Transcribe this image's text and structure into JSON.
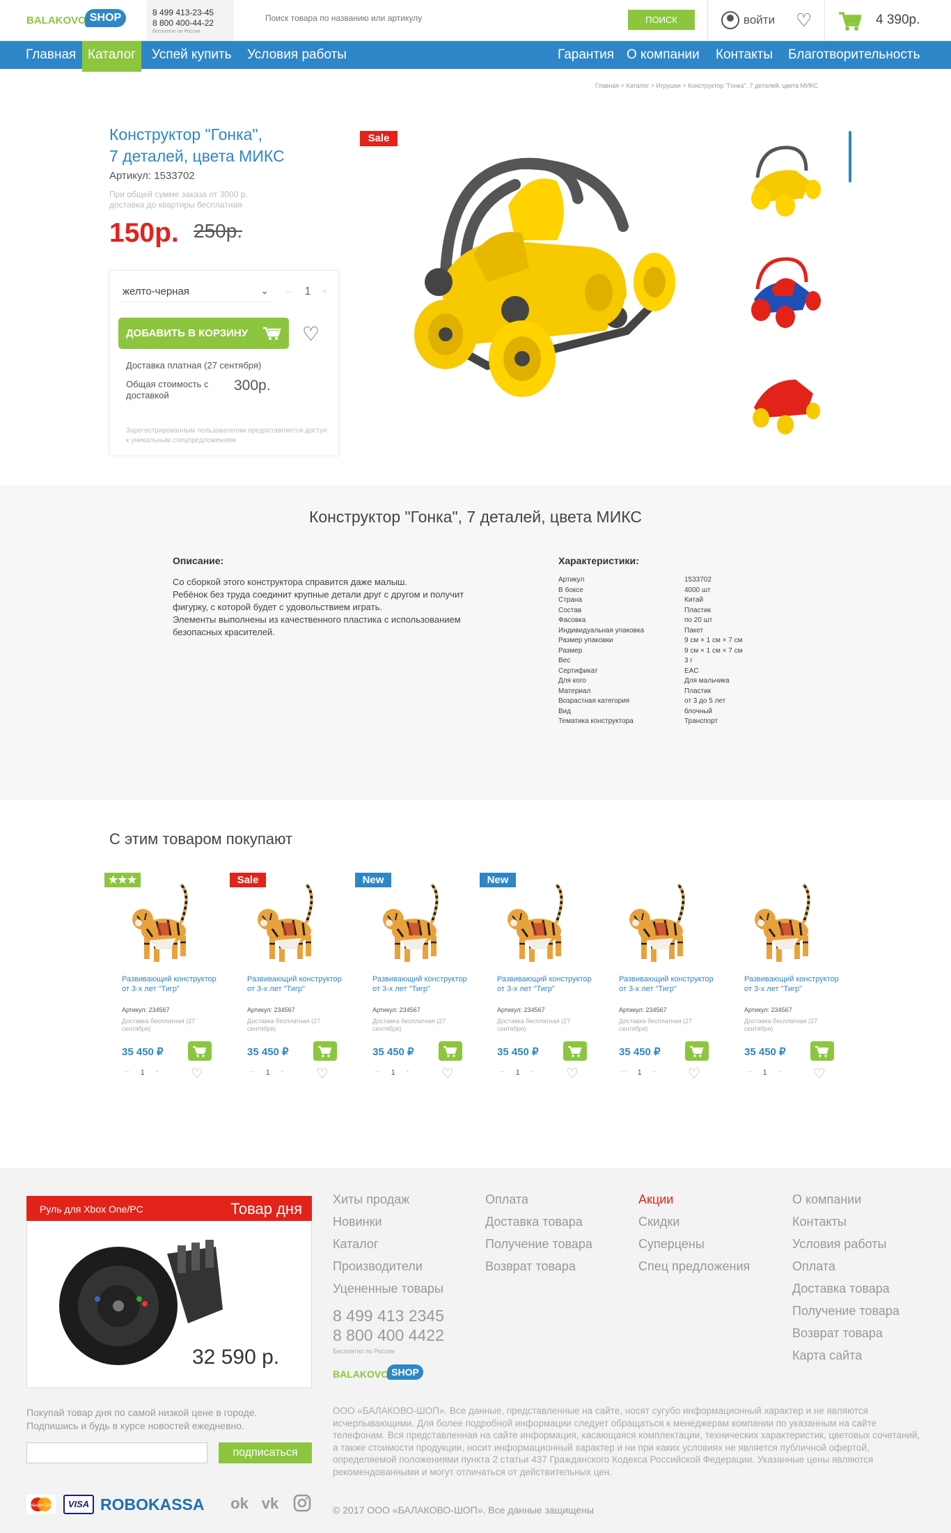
{
  "header": {
    "logo_part1": "BALAKOVO",
    "logo_part2": "SHOP",
    "phone1": "8 499 413-23-45",
    "phone2": "8 800 400-44-22",
    "phone_note": "бесплатно по России",
    "search_placeholder": "Поиск товара по названию или артикулу",
    "search_button": "ПОИСК",
    "login": "войти",
    "cart_total": "4 390р."
  },
  "nav": {
    "left": [
      "Главная",
      "Каталог",
      "Успей купить",
      "Условия работы"
    ],
    "right": [
      "Гарантия",
      "О компании",
      "Контакты",
      "Благотворительность"
    ],
    "active": "Каталог"
  },
  "breadcrumb": "Главная > Каталог > Игрушки > Конструктор \"Гонка\", 7 деталей, цвета МИКС",
  "product": {
    "title_line1": "Конструктор \"Гонка\",",
    "title_line2": "7 деталей, цвета МИКС",
    "article": "Артикул: 1533702",
    "note_line1": "При общей сумме заказа от 3000 р.",
    "note_line2": "доставка до квартиры бесплатная",
    "price": "150р.",
    "old_price": "250р.",
    "badge": "Sale",
    "variant": "желто-черная",
    "quantity": "1",
    "add_to_cart": "ДОБАВИТЬ В КОРЗИНУ",
    "delivery": "Доставка платная (27 сентября)",
    "total_label": "Общая стоимость с доставкой",
    "total_value": "300р.",
    "registered_note": "Зарегестрированным пользователям предоставляется доступ к уникальным спецпредложениям"
  },
  "description": {
    "title": "Конструктор \"Гонка\", 7 деталей, цвета МИКС",
    "desc_label": "Описание:",
    "desc_lines": [
      "Со сборкой этого конструктора справится даже малыш.",
      "Ребёнок без труда соединит крупные детали друг с другом и получит",
      "фигурку, с которой будет с удовольствием играть.",
      "Элементы выполнены из качественного пластика с использованием",
      "безопасных красителей."
    ],
    "specs_label": "Характеристики:",
    "specs": [
      {
        "k": "Артикул",
        "v": "1533702"
      },
      {
        "k": "В боксе",
        "v": "4000 шт"
      },
      {
        "k": "Страна",
        "v": "Китай"
      },
      {
        "k": "Состав",
        "v": "Пластик"
      },
      {
        "k": "Фасовка",
        "v": "по 20 шт"
      },
      {
        "k": "Индивидуальная упаковка",
        "v": "Пакет"
      },
      {
        "k": "Размер упаковки",
        "v": "9 см × 1 см × 7 см"
      },
      {
        "k": "Размер",
        "v": "9 см × 1 см × 7 см"
      },
      {
        "k": "Вес",
        "v": "3 г"
      },
      {
        "k": "Сертификат",
        "v": "EAC"
      },
      {
        "k": "Для кого",
        "v": "Для мальчика"
      },
      {
        "k": "Материал",
        "v": "Пластик"
      },
      {
        "k": "Возрастная категория",
        "v": "от 3 до 5 лет"
      },
      {
        "k": "Вид",
        "v": "блочный"
      },
      {
        "k": "Тематика конструктора",
        "v": "Транспорт"
      }
    ]
  },
  "related": {
    "title": "С этим товаром покупают",
    "items": [
      {
        "badge": "★★★",
        "badge_color": "#8cc63f",
        "name": "Развивающий конструктор от 3-х лет \"Тигр\"",
        "article": "Артикул: 234567",
        "delivery": "Доставка бесплатная (27 сентября)",
        "price": "35 450 ₽",
        "qty": "1"
      },
      {
        "badge": "Sale",
        "badge_color": "#e2231a",
        "name": "Развивающий конструктор от 3-х лет \"Тигр\"",
        "article": "Артикул: 234567",
        "delivery": "Доставка бесплатная (27 сентября)",
        "price": "35 450 ₽",
        "qty": "1"
      },
      {
        "badge": "New",
        "badge_color": "#2e86c8",
        "name": "Развивающий конструктор от 3-х лет \"Тигр\"",
        "article": "Артикул: 234567",
        "delivery": "Доставка бесплатная (27 сентября)",
        "price": "35 450 ₽",
        "qty": "1"
      },
      {
        "badge": "New",
        "badge_color": "#2e86c8",
        "name": "Развивающий конструктор от 3-х лет \"Тигр\"",
        "article": "Артикул: 234567",
        "delivery": "Доставка бесплатная (27 сентября)",
        "price": "35 450 ₽",
        "qty": "1"
      },
      {
        "badge": "",
        "badge_color": "",
        "name": "Развивающий конструктор от 3-х лет \"Тигр\"",
        "article": "Артикул: 234567",
        "delivery": "Доставка бесплатная (27 сентября)",
        "price": "35 450 ₽",
        "qty": "1"
      },
      {
        "badge": "",
        "badge_color": "",
        "name": "Развивающий конструктор от 3-х лет \"Тигр\"",
        "article": "Артикул: 234567",
        "delivery": "Доставка бесплатная (27 сентября)",
        "price": "35 450 ₽",
        "qty": "1"
      }
    ]
  },
  "footer": {
    "day_product_name": "Руль для Xbox One/PC",
    "day_product_label": "Товар дня",
    "day_product_price": "32 590 р.",
    "col1": [
      "Хиты продаж",
      "Новинки",
      "Каталог",
      "Производители",
      "Уцененные товары"
    ],
    "col2": [
      "Оплата",
      "Доставка товара",
      "Получение товара",
      "Возврат товара"
    ],
    "col3": [
      "Акции",
      "Скидки",
      "Суперцены",
      "Спец предложения"
    ],
    "col4": [
      "О компании",
      "Контакты",
      "Условия работы",
      "Оплата",
      "Доставка товара",
      "Получение товара",
      "Возврат товара",
      "Карта сайта"
    ],
    "phone1": "8 499 413 2345",
    "phone2": "8 800 400 4422",
    "phone_note": "Бесплатно по России",
    "subscribe_text": "Покупай товар дня по самой низкой цене в городе. Подпишись и будь в курсе новостей ежедневно.",
    "subscribe_button": "подписаться",
    "legal": "ООО «БАЛАКОВО-ШОП». Все данные, представленные на сайте, носят сугубо информационный характер и не являются исчерпывающими. Для более подробной информации следует обращаться к менеджерам компании по указанным на сайте телефонам. Вся представленная на сайте информация, касающаяся комплектации, технических характеристик, цветовых сочетаний, а также стоимости продукции, носит информационный характер и ни при каких условиях не является публичной офертой, определяемой положениями пункта 2 статьи 437 Гражданского Кодекса Российской Федерации. Указанные цены являются рекомендованными и могут отличаться от действительных цен.",
    "copyright": "© 2017 ООО «БАЛАКОВО-ШОП». Все данные защищены",
    "pay_visa": "VISA",
    "pay_mc": "MasterCard",
    "pay_robo": "ROBOKASSA",
    "socials": [
      "ok-icon",
      "vk-icon",
      "instagram-icon"
    ]
  },
  "colors": {
    "brand_blue": "#2e86c8",
    "brand_green": "#8cc63f",
    "sale_red": "#e2231a"
  }
}
